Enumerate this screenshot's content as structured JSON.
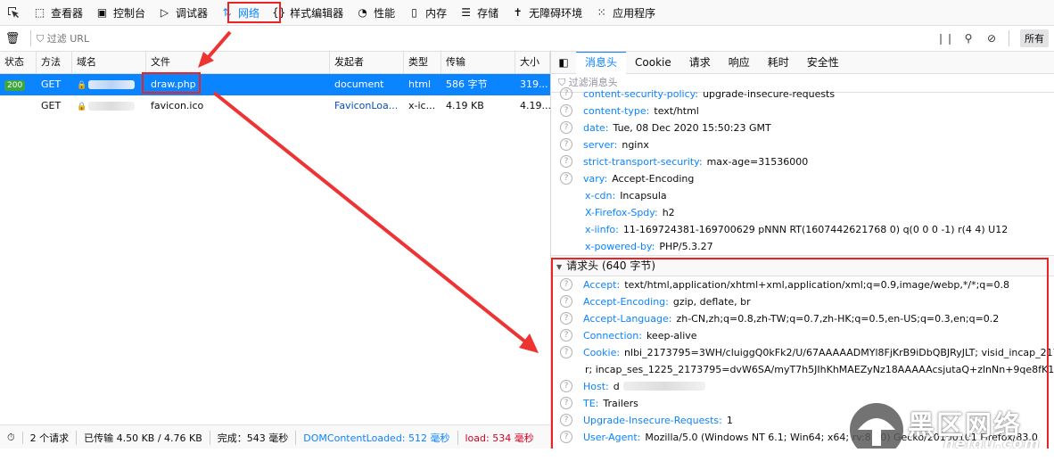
{
  "toolbar": {
    "tabs": [
      {
        "label": "查看器",
        "icon": "inspector-icon"
      },
      {
        "label": "控制台",
        "icon": "console-icon"
      },
      {
        "label": "调试器",
        "icon": "debugger-icon"
      },
      {
        "label": "网络",
        "icon": "network-icon",
        "active": true
      },
      {
        "label": "样式编辑器",
        "icon": "style-editor-icon"
      },
      {
        "label": "性能",
        "icon": "performance-icon"
      },
      {
        "label": "内存",
        "icon": "memory-icon"
      },
      {
        "label": "存储",
        "icon": "storage-icon"
      },
      {
        "label": "无障碍环境",
        "icon": "accessibility-icon"
      },
      {
        "label": "应用程序",
        "icon": "application-icon"
      }
    ]
  },
  "filter": {
    "placeholder": "过滤 URL",
    "all_label": "所有"
  },
  "table": {
    "columns": [
      "状态",
      "方法",
      "域名",
      "文件",
      "发起者",
      "类型",
      "传输",
      "大小"
    ],
    "rows": [
      {
        "status": "200",
        "method": "GET",
        "file": "draw.php",
        "initiator": "document",
        "type": "html",
        "transferred": "586 字节",
        "size": "319..."
      },
      {
        "status": "",
        "method": "GET",
        "file": "favicon.ico",
        "initiator": "FaviconLoa...",
        "type": "x-ic...",
        "transferred": "4.19 KB",
        "size": "4.19..."
      }
    ]
  },
  "statusbar": {
    "requests": "2 个请求",
    "transferred": "已传输 4.50 KB / 4.76 KB",
    "finish": "完成：543 毫秒",
    "domcontentloaded": "DOMContentLoaded: 512 毫秒",
    "load": "load: 534 毫秒"
  },
  "details": {
    "tabs": [
      "消息头",
      "Cookie",
      "请求",
      "响应",
      "耗时",
      "安全性"
    ],
    "filter_placeholder": "过滤消息头",
    "response_headers": [
      {
        "name": "content-security-policy:",
        "value": "upgrade-insecure-requests",
        "q": true
      },
      {
        "name": "content-type:",
        "value": "text/html",
        "q": true
      },
      {
        "name": "date:",
        "value": "Tue, 08 Dec 2020 15:50:23 GMT",
        "q": true
      },
      {
        "name": "server:",
        "value": "nginx",
        "q": true
      },
      {
        "name": "strict-transport-security:",
        "value": "max-age=31536000",
        "q": true
      },
      {
        "name": "vary:",
        "value": "Accept-Encoding",
        "q": true
      },
      {
        "name": "x-cdn:",
        "value": "Incapsula",
        "q": false
      },
      {
        "name": "X-Firefox-Spdy:",
        "value": "h2",
        "q": false
      },
      {
        "name": "x-iinfo:",
        "value": "11-169724381-169700629 pNNN RT(1607442621768 0) q(0 0 0 -1) r(4 4) U12",
        "q": false
      },
      {
        "name": "x-powered-by:",
        "value": "PHP/5.3.27",
        "q": false
      }
    ],
    "request_section": "请求头 (640 字节)",
    "request_headers": [
      {
        "name": "Accept:",
        "value": "text/html,application/xhtml+xml,application/xml;q=0.9,image/webp,*/*;q=0.8"
      },
      {
        "name": "Accept-Encoding:",
        "value": "gzip, deflate, br"
      },
      {
        "name": "Accept-Language:",
        "value": "zh-CN,zh;q=0.8,zh-TW;q=0.7,zh-HK;q=0.5,en-US;q=0.3,en;q=0.2"
      },
      {
        "name": "Connection:",
        "value": "keep-alive"
      },
      {
        "name": "Cookie:",
        "value": "nlbi_2173795=3WH/cluiggQ0kFk2/U/67AAAAADMYl8FjKrB9iDbQBJRyJLT; visid_incap_2173",
        "cont": "r; incap_ses_1225_2173795=dvW6SA/myT7h5JIhKhMAEZyNz18AAAAAcsjutaQ+zlnNn+9qe8fK1Q=="
      },
      {
        "name": "Host:",
        "value": "d"
      },
      {
        "name": "TE:",
        "value": "Trailers"
      },
      {
        "name": "Upgrade-Insecure-Requests:",
        "value": "1"
      },
      {
        "name": "User-Agent:",
        "value": "Mozilla/5.0 (Windows NT 6.1; Win64; x64; rv:83.0) Gecko/20100101 Firefox/83.0"
      }
    ]
  },
  "watermark": {
    "text": "黑区网络",
    "url": "heiqu.com"
  }
}
